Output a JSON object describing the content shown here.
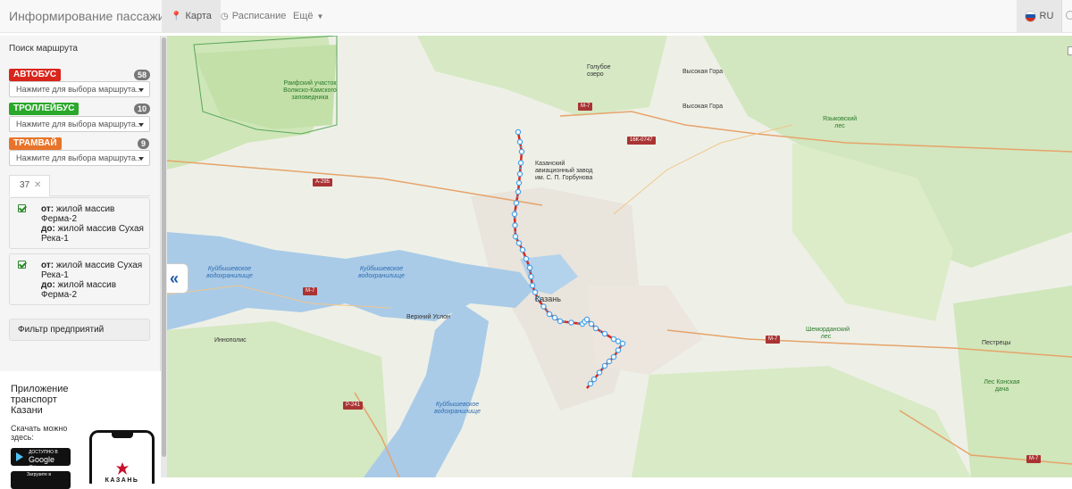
{
  "navbar": {
    "brand": "Информирование пассажиров",
    "tabs": [
      {
        "label": "Карта",
        "icon": "map-marker-icon"
      },
      {
        "label": "Расписание",
        "icon": "clock-icon"
      },
      {
        "label": "Ещё",
        "icon": "caret-down-icon"
      }
    ],
    "language": "RU"
  },
  "sidebar": {
    "title": "Поиск маршрута",
    "transport_types": [
      {
        "label": "АВТОБУС",
        "count": "58",
        "color": "#d9251c",
        "placeholder": "Нажмите для выбора маршрута..."
      },
      {
        "label": "ТРОЛЛЕЙБУС",
        "count": "10",
        "color": "#2aa82a",
        "placeholder": "Нажмите для выбора маршрута..."
      },
      {
        "label": "ТРАМВАЙ",
        "count": "9",
        "color": "#e8742a",
        "placeholder": "Нажмите для выбора маршрута..."
      }
    ],
    "selected_route_tab": "37",
    "directions": [
      {
        "from_label": "от:",
        "from": "жилой массив Ферма-2",
        "to_label": "до:",
        "to": "жилой массив Сухая Река-1"
      },
      {
        "from_label": "от:",
        "from": "жилой массив Сухая Река-1",
        "to_label": "до:",
        "to": "жилой массив Ферма-2"
      }
    ],
    "filter_button": "Фильтр предприятий",
    "promo": {
      "title": "Приложение транспорт Казани",
      "subtitle": "Скачать можно здесь:",
      "google_play_small": "ДОСТУПНО В",
      "google_play": "Google Play",
      "app_store_small": "Загрузите в",
      "phone_logo_text": "КАЗАНЬ"
    }
  },
  "map": {
    "labels": [
      {
        "text": "Раифский участок Волжско-Камского заповедника"
      },
      {
        "text": "Голубое озеро"
      },
      {
        "text": "Высокая Гора"
      },
      {
        "text": "Высокая Гора"
      },
      {
        "text": "Казанский авиационный завод им. С. П. Горбунова"
      },
      {
        "text": "Языковский лес"
      },
      {
        "text": "Казань"
      },
      {
        "text": "Верхний Услон"
      },
      {
        "text": "Иннополис"
      },
      {
        "text": "Шеморданский лес"
      },
      {
        "text": "Пестрецы"
      },
      {
        "text": "Лес Конская дача"
      }
    ],
    "water_labels": [
      "Куйбышевское водохранилище",
      "Куйбышевское водохранилище",
      "Куйбышевское водохранилище"
    ],
    "road_shields": [
      "М-7",
      "16К-0747",
      "А-295",
      "М-7",
      "М-7",
      "Р-241",
      "М-7"
    ],
    "route_color": "#d9251c",
    "stop_color": "#4aa3e8"
  }
}
